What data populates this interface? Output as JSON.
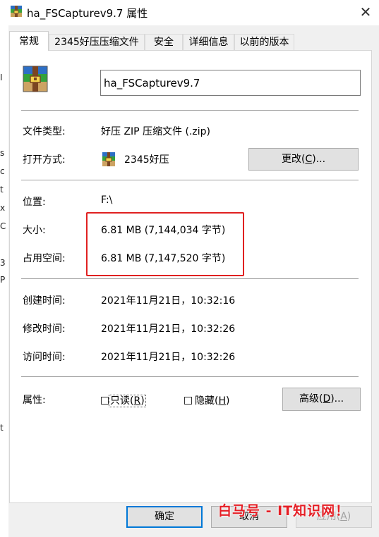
{
  "window": {
    "title": "ha_FSCapturev9.7 属性",
    "close_glyph": "✕"
  },
  "bg_strip_chars": [
    "I",
    "s",
    "c",
    "t",
    "x",
    "C",
    "3",
    "P",
    "t"
  ],
  "tabs": [
    {
      "label": "常规",
      "active": true
    },
    {
      "label": "2345好压压缩文件",
      "active": false
    },
    {
      "label": "安全",
      "active": false
    },
    {
      "label": "详细信息",
      "active": false
    },
    {
      "label": "以前的版本",
      "active": false
    }
  ],
  "general": {
    "file_name": "ha_FSCapturev9.7",
    "file_type_label": "文件类型:",
    "file_type_value": "好压 ZIP 压缩文件 (.zip)",
    "open_with_label": "打开方式:",
    "open_with_value": "2345好压",
    "change_button": {
      "text": "更改(",
      "key": "C",
      "after": ")..."
    },
    "location_label": "位置:",
    "location_value": "F:\\",
    "size_label": "大小:",
    "size_value": "6.81 MB (7,144,034 字节)",
    "disk_size_label": "占用空间:",
    "disk_size_value": "6.81 MB (7,147,520 字节)",
    "created_label": "创建时间:",
    "created_value": "2021年11月21日，10:32:16",
    "modified_label": "修改时间:",
    "modified_value": "2021年11月21日，10:32:26",
    "accessed_label": "访问时间:",
    "accessed_value": "2021年11月21日，10:32:26",
    "attributes_label": "属性:",
    "readonly": {
      "text": "只读(",
      "key": "R",
      "after": ")",
      "checked": false
    },
    "hidden": {
      "text": "隐藏(",
      "key": "H",
      "after": ")",
      "checked": false
    },
    "advanced_button": {
      "text": "高级(",
      "key": "D",
      "after": ")..."
    }
  },
  "footer": {
    "ok_label": "确定",
    "cancel_label": "取消",
    "apply": {
      "text": "应用(",
      "key": "A",
      "after": ")"
    }
  },
  "watermark": "白马号 - IT知识网！",
  "colors": {
    "highlight": "#e02020",
    "watermark": "#e51e25"
  }
}
